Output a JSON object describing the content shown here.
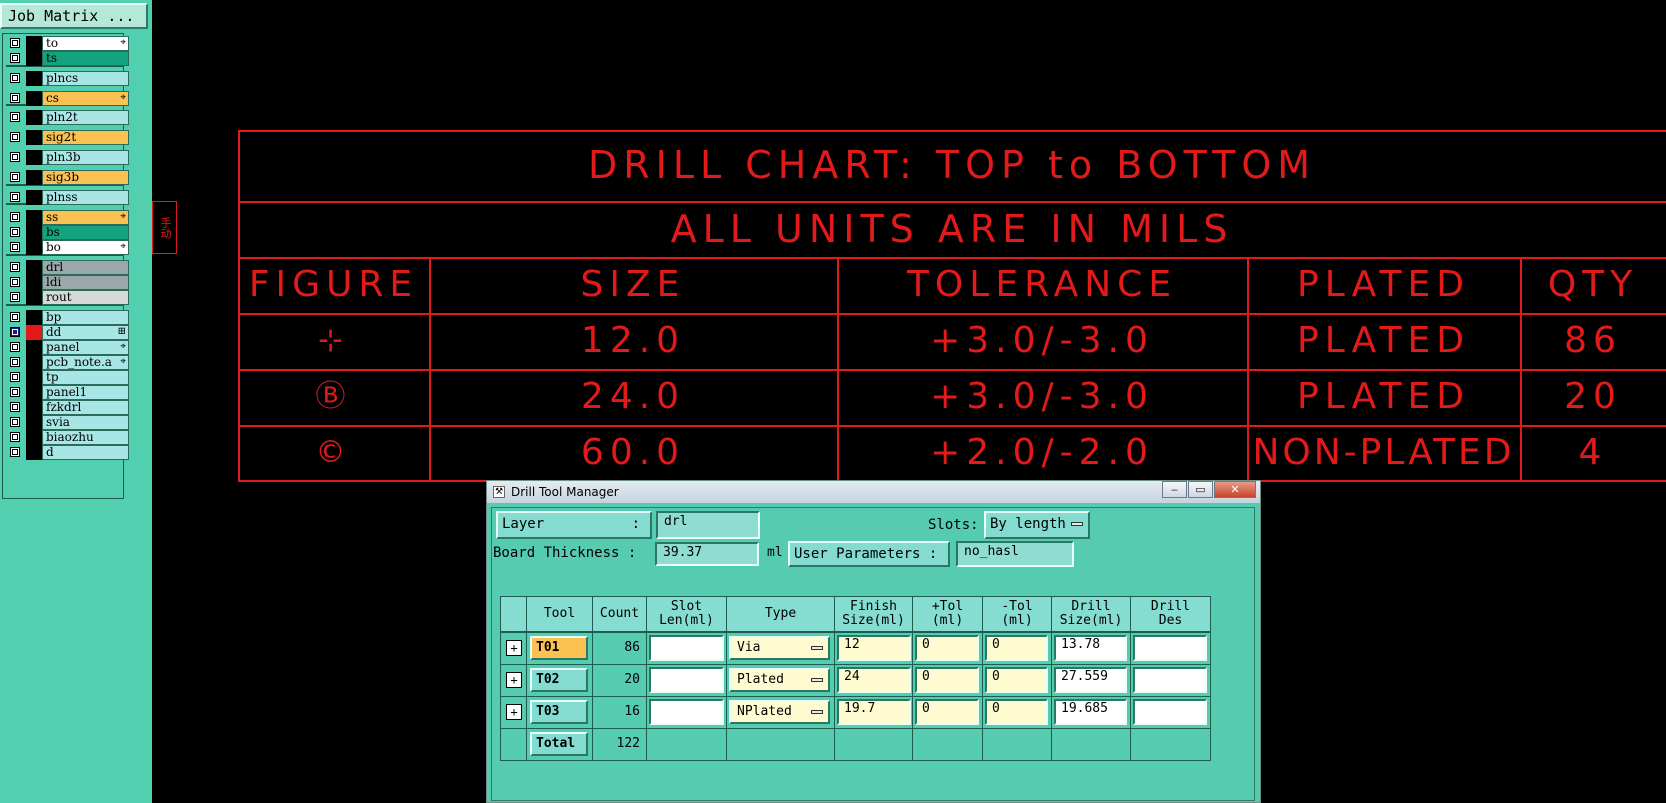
{
  "job_matrix_button": "Job Matrix ...",
  "layers": [
    {
      "name": "to",
      "color": "white",
      "mark": "⌖"
    },
    {
      "name": "ts",
      "color": "green",
      "mark": ""
    },
    {
      "name": "plncs",
      "color": "light",
      "mark": ""
    },
    {
      "name": "cs",
      "color": "orange",
      "mark": "⌖"
    },
    {
      "name": "pln2t",
      "color": "light",
      "mark": ""
    },
    {
      "name": "sig2t",
      "color": "orange",
      "mark": ""
    },
    {
      "name": "pln3b",
      "color": "light",
      "mark": ""
    },
    {
      "name": "sig3b",
      "color": "orange",
      "mark": ""
    },
    {
      "name": "plnss",
      "color": "light",
      "mark": ""
    },
    {
      "name": "ss",
      "color": "orange",
      "mark": "⌖"
    },
    {
      "name": "bs",
      "color": "green",
      "mark": ""
    },
    {
      "name": "bo",
      "color": "white",
      "mark": "⌖"
    },
    {
      "name": "drl",
      "color": "gray",
      "mark": ""
    },
    {
      "name": "ldi",
      "color": "gray",
      "mark": ""
    },
    {
      "name": "rout",
      "color": "lgray",
      "mark": ""
    },
    {
      "name": "bp",
      "color": "light",
      "mark": ""
    },
    {
      "name": "dd",
      "color": "light",
      "mark": "⊞"
    },
    {
      "name": "panel",
      "color": "light",
      "mark": "⌖"
    },
    {
      "name": "pcb_note.a",
      "color": "light",
      "mark": "⌖"
    },
    {
      "name": "tp",
      "color": "light",
      "mark": ""
    },
    {
      "name": "panel1",
      "color": "light",
      "mark": ""
    },
    {
      "name": "fzkdrl",
      "color": "light",
      "mark": ""
    },
    {
      "name": "svia",
      "color": "light",
      "mark": ""
    },
    {
      "name": "biaozhu",
      "color": "light",
      "mark": ""
    },
    {
      "name": "d",
      "color": "light",
      "mark": ""
    }
  ],
  "side_tab": "手动",
  "drill_chart": {
    "title": "DRILL CHART: TOP to BOTTOM",
    "subtitle": "ALL UNITS ARE IN MILS",
    "headers": [
      "FIGURE",
      "SIZE",
      "TOLERANCE",
      "PLATED",
      "QTY"
    ],
    "rows": [
      {
        "figure": "⊹",
        "size": "12.0",
        "tolerance": "+3.0/-3.0",
        "plated": "PLATED",
        "qty": "86"
      },
      {
        "figure": "Ⓑ",
        "size": "24.0",
        "tolerance": "+3.0/-3.0",
        "plated": "PLATED",
        "qty": "20"
      },
      {
        "figure": "©",
        "size": "60.0",
        "tolerance": "+2.0/-2.0",
        "plated": "NON-PLATED",
        "qty": "4"
      }
    ]
  },
  "window": {
    "title": "Drill Tool Manager",
    "minimize": "‒",
    "maximize": "▭",
    "close": "✕",
    "layer_label": "Layer",
    "layer_colon": ":",
    "layer_value": "drl",
    "slots_label": "Slots:",
    "slots_value": "By length",
    "board_thickness_label": "Board Thickness :",
    "board_thickness_value": "39.37",
    "board_thickness_unit": "ml",
    "user_params_label": "User Parameters :",
    "user_params_value": "no_hasl",
    "columns": [
      "Tool",
      "Count",
      "Slot\nLen(ml)",
      "Type",
      "Finish\nSize(ml)",
      "+Tol\n(ml)",
      "-Tol\n(ml)",
      "Drill\nSize(ml)",
      "Drill\nDes"
    ],
    "tools": [
      {
        "tool": "T01",
        "count": "86",
        "slot_len": "",
        "type": "Via",
        "finish": "12",
        "ptol": "0",
        "ntol": "0",
        "drill_size": "13.78",
        "drill_des": "",
        "highlight": true
      },
      {
        "tool": "T02",
        "count": "20",
        "slot_len": "",
        "type": "Plated",
        "finish": "24",
        "ptol": "0",
        "ntol": "0",
        "drill_size": "27.559",
        "drill_des": "",
        "highlight": false
      },
      {
        "tool": "T03",
        "count": "16",
        "slot_len": "",
        "type": "NPlated",
        "finish": "19.7",
        "ptol": "0",
        "ntol": "0",
        "drill_size": "19.685",
        "drill_des": "",
        "highlight": false
      }
    ],
    "total_label": "Total",
    "total_count": "122"
  }
}
